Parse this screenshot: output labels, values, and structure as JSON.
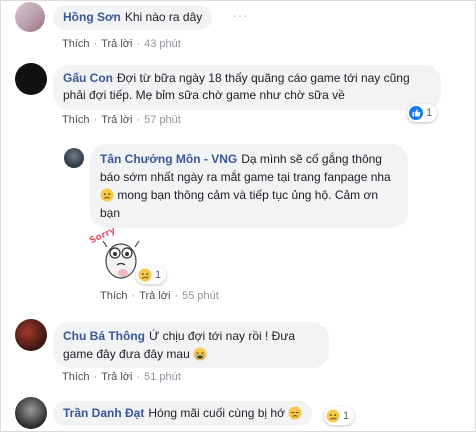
{
  "comments": [
    {
      "author": "Hồng Sơn",
      "text": "Khi nào ra dây",
      "like": "Thích",
      "reply": "Trả lời",
      "time": "43 phút"
    },
    {
      "author": "Gấu Con",
      "text": "Đợi từ bữa ngày 18 thấy quãng cáo game tới nay cũng phải đợi tiếp. Mẹ bỉm sữa chờ game như chờ sữa về",
      "like": "Thích",
      "reply": "Trả lời",
      "time": "57 phút",
      "reaction_count": "1"
    },
    {
      "author": "Tân Chưởng Môn - VNG",
      "text_part1": "Dạ mình sẽ cố gắng thông báo sớm nhất ngày ra mắt game tại trang fanpage nha",
      "text_part2": "mong bạn thông cảm và tiếp tục ủng hộ. Cảm ơn bạn",
      "sticker_text": "Sorry",
      "like": "Thích",
      "reply": "Trả lời",
      "time": "55 phút",
      "reaction_count": "1"
    },
    {
      "author": "Chu Bá Thông",
      "text": "Ứ chịu đợi tới nay rồi ! Đưa game đây đưa đây mau",
      "like": "Thích",
      "reply": "Trả lời",
      "time": "51 phút"
    },
    {
      "author": "Trần Danh Đạt",
      "text": "Hóng mãi cuối cùng bị hớ",
      "reaction_count": "1"
    }
  ],
  "icons": {
    "more": "more-options-icon",
    "like_reaction": "like-reaction-icon",
    "sad_reaction": "sad-reaction-icon",
    "sad_emoji": "sad-emoji-icon",
    "cry_emoji": "crying-emoji-icon",
    "disappointed_emoji": "disappointed-emoji-icon"
  },
  "colors": {
    "author": "#385898",
    "bubble": "#f2f3f5",
    "like_blue": "#1877f2",
    "emoji_yellow": "#f7c84a"
  }
}
